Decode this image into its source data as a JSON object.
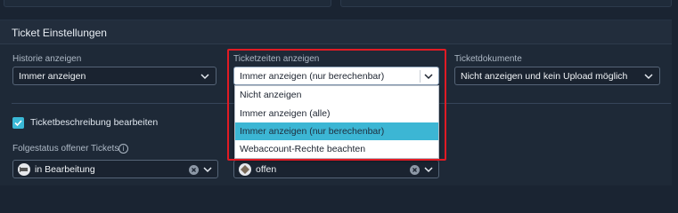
{
  "panel": {
    "title": "Ticket Einstellungen"
  },
  "historie": {
    "label": "Historie anzeigen",
    "value": "Immer anzeigen"
  },
  "ticketzeiten": {
    "label": "Ticketzeiten anzeigen",
    "value": "Immer anzeigen (nur berechenbar)",
    "options": [
      "Nicht anzeigen",
      "Immer anzeigen (alle)",
      "Immer anzeigen (nur berechenbar)",
      "Webaccount-Rechte beachten"
    ],
    "selected_index": 2
  },
  "ticketdokumente": {
    "label": "Ticketdokumente",
    "value": "Nicht anzeigen und kein Upload möglich"
  },
  "ticketbeschreibung": {
    "label": "Ticketbeschreibung bearbeiten",
    "checked": true
  },
  "folgestatus": {
    "label": "Folgestatus offener Tickets",
    "value_1": "in Bearbeitung",
    "value_2": "offen"
  },
  "colors": {
    "accent": "#3ab8d6",
    "highlight_border": "#e01b24",
    "background": "#1a2432"
  },
  "icons": {
    "chevron": "chevron-down-icon",
    "clear": "clear-icon",
    "info": "info-icon",
    "check": "check-icon"
  }
}
